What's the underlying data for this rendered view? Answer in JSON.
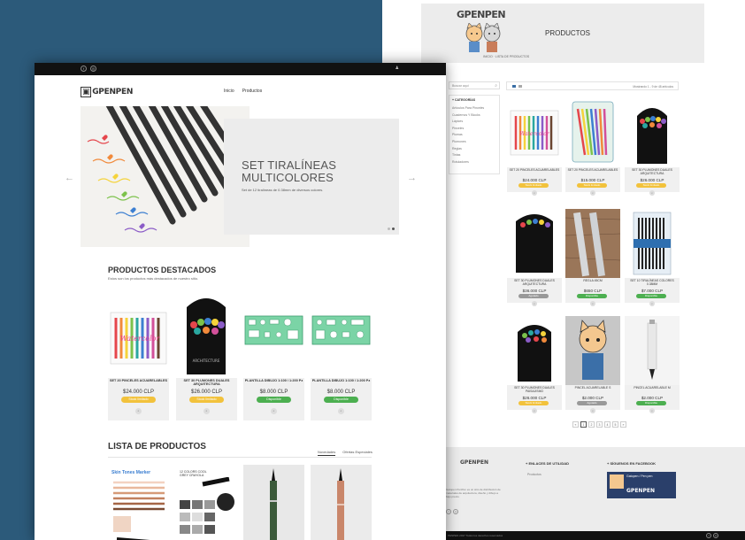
{
  "back_page": {
    "logo_text": "GPENPEN",
    "page_title": "PRODUCTOS",
    "breadcrumb": "INICIO  ·  LISTA DE PRODUCTOS",
    "search_placeholder": "Buscar aquí",
    "categories_title": "+ CATEGORÍAS",
    "categories": [
      "Artículos Para Pinceles",
      "Cuadernos Y Blocks",
      "Lápices",
      "Pinceles",
      "Plumas",
      "Plumones",
      "Reglas",
      "Tintas",
      "Rotuladores"
    ],
    "showing_text": "Mostrando 1 - 9 de 48 artículos",
    "products": [
      {
        "name": "SET 20 PINCELES ACUARELABLES",
        "price": "$24.000 CLP",
        "stock": "Stock limitado",
        "stock_type": "yellow"
      },
      {
        "name": "SET 20 PINCELES ACUARELABLES",
        "price": "$15.000 CLP",
        "stock": "Stock limitado",
        "stock_type": "yellow"
      },
      {
        "name": "SET 30 PLUMONES DUALES ARQUITECTURA",
        "price": "$26.000 CLP",
        "stock": "Stock limitado",
        "stock_type": "yellow"
      },
      {
        "name": "SET 30 PLUMONES DUALES ARQUITECTURA",
        "price": "$36.000 CLP",
        "stock": "Agotado",
        "stock_type": "grey"
      },
      {
        "name": "REGLA 45CM",
        "price": "$650 CLP",
        "stock": "Disponible",
        "stock_type": "green"
      },
      {
        "name": "SET 10 TIRALÍNEAS COLORES 0.38MM",
        "price": "$7.000 CLP",
        "stock": "Disponible",
        "stock_type": "green"
      },
      {
        "name": "SET 30 PLUMONES DUALES PAISAJISMO",
        "price": "$26.000 CLP",
        "stock": "Stock limitado",
        "stock_type": "yellow"
      },
      {
        "name": "PINCEL ACUARELABLE S",
        "price": "$2.000 CLP",
        "stock": "Agotado",
        "stock_type": "grey"
      },
      {
        "name": "PINCEL ACUARELABLE M",
        "price": "$2.000 CLP",
        "stock": "Disponible",
        "stock_type": "green"
      }
    ],
    "pagination": [
      "«",
      "1",
      "2",
      "3",
      "4",
      "5",
      "»"
    ],
    "footer_links_title": "+ ENLACES DE UTILIDAD",
    "footer_link": "Productos",
    "footer_fb_title": "+ SÍGUENOS EN FACEBOOK",
    "footer_fb_page": "Gatopen / Pen pen",
    "footer_about": "Gatopen PenPen es un sitio de distribución de materiales de arquitectura, diseño y dibujo a bajo precio.",
    "copyright": "PENPEN 2017 Todos los derechos reservados"
  },
  "front_page": {
    "logo_text": "GPENPEN",
    "nav": [
      "Inicio",
      "Productos"
    ],
    "hero_title_line1": "SET TIRALÍNEAS",
    "hero_title_line2": "MULTICOLORES",
    "hero_subtitle": "Set de 12 tiralíneas de 0.38mm de diversos colores.",
    "featured_title": "PRODUCTOS DESTACADOS",
    "featured_subtitle": "Estos son los productos más destacados de nuestro sitio.",
    "featured": [
      {
        "name": "SET 20 PINCELES ACUARELABLES",
        "price": "$24.000 CLP",
        "stock": "Stock limitado",
        "stock_type": "yellow"
      },
      {
        "name": "SET 30 PLUMONES DUALES ARQUITECTURA",
        "price": "$26.000 CLP",
        "stock": "Stock limitado",
        "stock_type": "yellow"
      },
      {
        "name": "PLANTILLA DIBUJO 1:100 / 1:200 Pz",
        "price": "$8.000 CLP",
        "stock": "Disponible",
        "stock_type": "green"
      },
      {
        "name": "PLANTILLA DIBUJO 1:100 / 1:200 Pz",
        "price": "$8.000 CLP",
        "stock": "Disponible",
        "stock_type": "green"
      }
    ],
    "list_title": "LISTA DE PRODUCTOS",
    "list_tabs": [
      "Novedades",
      "Ofertas Especiales"
    ],
    "list_card1_title": "Skin Tones Marker",
    "list_card2_title": "12 COLORS COOL GREY CRAYOLA"
  },
  "colors": {
    "background": "#2c5a7a",
    "stock_yellow": "#f2c23c",
    "stock_green": "#4caf50",
    "stock_grey": "#999999",
    "topbar": "#111111"
  }
}
